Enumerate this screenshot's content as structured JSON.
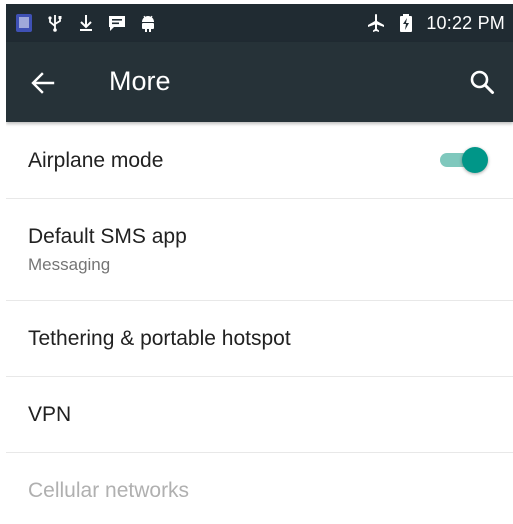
{
  "status_bar": {
    "time": "10:22 PM",
    "left_icons": [
      "phone-app-icon",
      "usb-icon",
      "download-icon",
      "message-icon",
      "android-icon"
    ],
    "right_icons": [
      "airplane-icon",
      "battery-icon"
    ]
  },
  "app_bar": {
    "title": "More",
    "back_icon": "arrow-left-icon",
    "search_icon": "search-icon",
    "color": "#263238"
  },
  "settings": [
    {
      "title": "Airplane mode",
      "toggle_on": true
    },
    {
      "title": "Default SMS app",
      "subtitle": "Messaging"
    },
    {
      "title": "Tethering & portable hotspot"
    },
    {
      "title": "VPN"
    },
    {
      "title": "Cellular networks",
      "disabled": true
    }
  ],
  "colors": {
    "accent": "#009688",
    "accent_track": "#7fc8bd",
    "status_bar": "#202b32",
    "disabled_text": "#b0b0b0"
  }
}
